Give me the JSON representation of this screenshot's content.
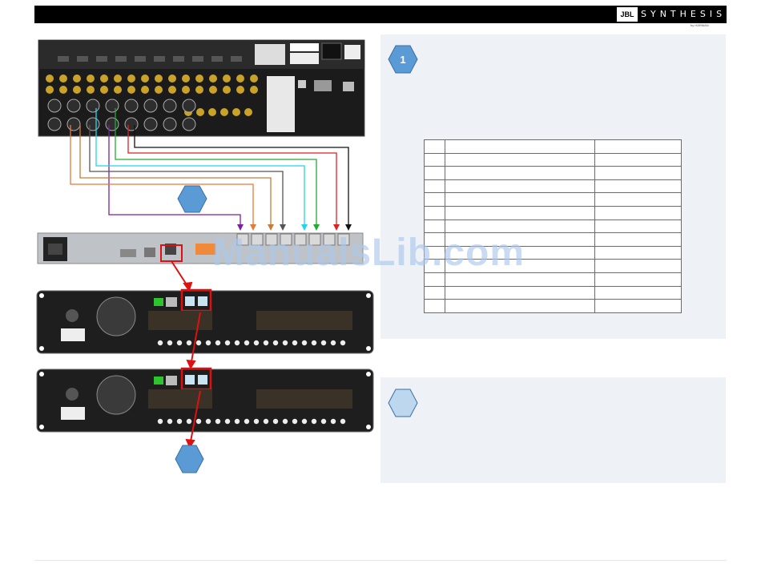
{
  "header": {
    "logo_text": "JBL",
    "brand": "SYNTHESIS",
    "brand_sub": "by HARMAN"
  },
  "step_badges": [
    "1",
    "",
    "",
    ""
  ],
  "watermark": "ManualsLib.com",
  "table": {
    "rows": 13,
    "cols": 3
  },
  "wire_colors": [
    "#7a1fa0",
    "#e57b3a",
    "#c97b3a",
    "#555555",
    "#22d3ee",
    "#22aa33",
    "#dd2222",
    "#111111"
  ],
  "accent": {
    "badge_fill": "#5b9bd5",
    "badge_light": "#bdd7ee",
    "link_red": "#e01010"
  }
}
